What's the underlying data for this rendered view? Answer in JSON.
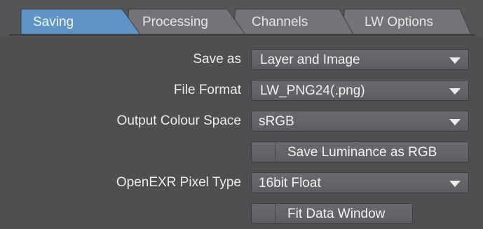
{
  "tabs": [
    {
      "label": "Saving",
      "active": true
    },
    {
      "label": "Processing",
      "active": false
    },
    {
      "label": "Channels",
      "active": false
    },
    {
      "label": "LW Options",
      "active": false
    }
  ],
  "fields": {
    "save_as": {
      "label": "Save as",
      "value": "Layer and Image"
    },
    "file_format": {
      "label": "File Format",
      "value": "LW_PNG24(.png)"
    },
    "output_colour_space": {
      "label": "Output Colour Space",
      "value": "sRGB"
    },
    "save_luminance": {
      "label": "Save Luminance as RGB",
      "checked": false
    },
    "openexr_pixel_type": {
      "label": "OpenEXR Pixel Type",
      "value": "16bit Float"
    },
    "fit_data_window": {
      "label": "Fit Data Window",
      "checked": false
    }
  },
  "colors": {
    "active_tab": "#5f95c6",
    "inactive_tab": "#78787c",
    "panel": "#4f4f52"
  }
}
